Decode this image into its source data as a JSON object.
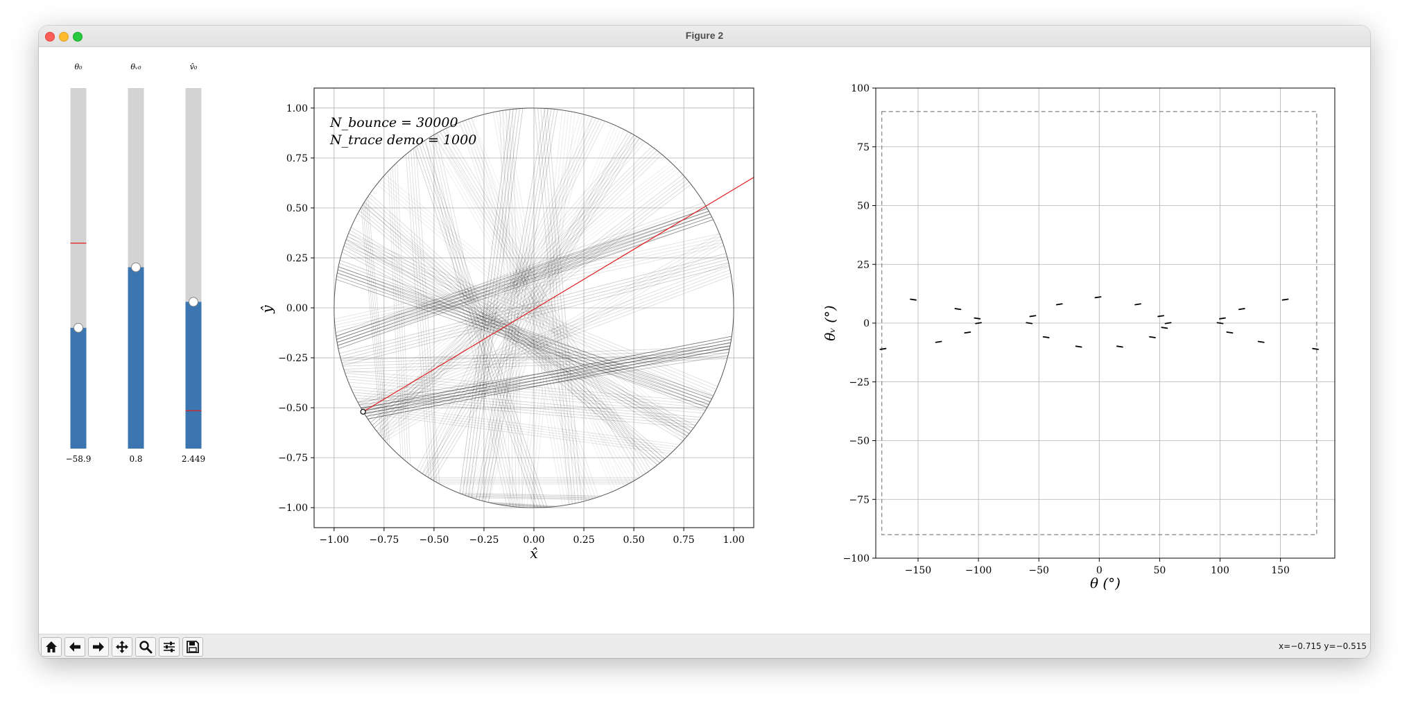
{
  "window": {
    "title": "Figure 2"
  },
  "sliders": [
    {
      "label": "θ₀",
      "value_text": "−58.9",
      "fraction": 0.335,
      "ref_fraction": 0.57
    },
    {
      "label": "θᵥ₀",
      "value_text": "0.8",
      "fraction": 0.503,
      "ref_fraction": null
    },
    {
      "label": "v̂₀",
      "value_text": "2.449",
      "fraction": 0.407,
      "ref_fraction": 0.105
    }
  ],
  "billiard_plot": {
    "xlabel": "x̂",
    "ylabel": "ŷ",
    "xlim": [
      -1.1,
      1.1
    ],
    "ylim": [
      -1.1,
      1.1
    ],
    "xticks": [
      "−1.00",
      "−0.75",
      "−0.50",
      "−0.25",
      "0.00",
      "0.25",
      "0.50",
      "0.75",
      "1.00"
    ],
    "yticks": [
      "1.00",
      "0.75",
      "0.50",
      "0.25",
      "0.00",
      "−0.25",
      "−0.50",
      "−0.75",
      "−1.00"
    ],
    "annotation_line1": "N_bounce = 30000",
    "annotation_line2": "N_trace demo = 1000",
    "start_point": [
      -0.855,
      -0.52
    ],
    "colors": {
      "trajectory": "#000000",
      "direction_line": "#e41a1c",
      "boundary": "#555555"
    }
  },
  "phase_plot": {
    "xlabel": "θ (°)",
    "ylabel": "θᵥ (°)",
    "xlim": [
      -185,
      195
    ],
    "ylim": [
      -100,
      100
    ],
    "xticks": [
      "−150",
      "−100",
      "−50",
      "0",
      "50",
      "100",
      "150"
    ],
    "yticks": [
      "100",
      "75",
      "50",
      "25",
      "0",
      "−25",
      "−50",
      "−75",
      "−100"
    ],
    "box": {
      "x": [
        -180,
        180
      ],
      "y": [
        -90,
        90
      ]
    }
  },
  "chart_data": [
    {
      "type": "scatter",
      "title": "",
      "xlabel": "θ (°)",
      "ylabel": "θᵥ (°)",
      "xlim": [
        -185,
        195
      ],
      "ylim": [
        -100,
        100
      ],
      "grid": true,
      "series": [
        {
          "x": [
            -179,
            -154,
            -133,
            -117,
            -109,
            -101,
            -100,
            -58,
            -55,
            -44,
            -33,
            -17,
            -1,
            17,
            32,
            44,
            51,
            54,
            57,
            100,
            102,
            108,
            118,
            134,
            154,
            179
          ],
          "y": [
            -11,
            10,
            -8,
            6,
            -4,
            2,
            0,
            0,
            3,
            -6,
            8,
            -10,
            11,
            -10,
            8,
            -6,
            3,
            -2,
            0,
            0,
            2,
            -4,
            6,
            -8,
            10,
            -11
          ]
        }
      ]
    }
  ],
  "toolbar": {
    "buttons": [
      {
        "name": "home-button",
        "icon": "home-icon"
      },
      {
        "name": "back-button",
        "icon": "arrow-left-icon"
      },
      {
        "name": "forward-button",
        "icon": "arrow-right-icon"
      },
      {
        "name": "pan-button",
        "icon": "move-icon"
      },
      {
        "name": "zoom-button",
        "icon": "magnifier-icon"
      },
      {
        "name": "configure-button",
        "icon": "sliders-icon"
      },
      {
        "name": "save-button",
        "icon": "save-icon"
      }
    ],
    "coords_text": "x=−0.715 y=−0.515"
  }
}
